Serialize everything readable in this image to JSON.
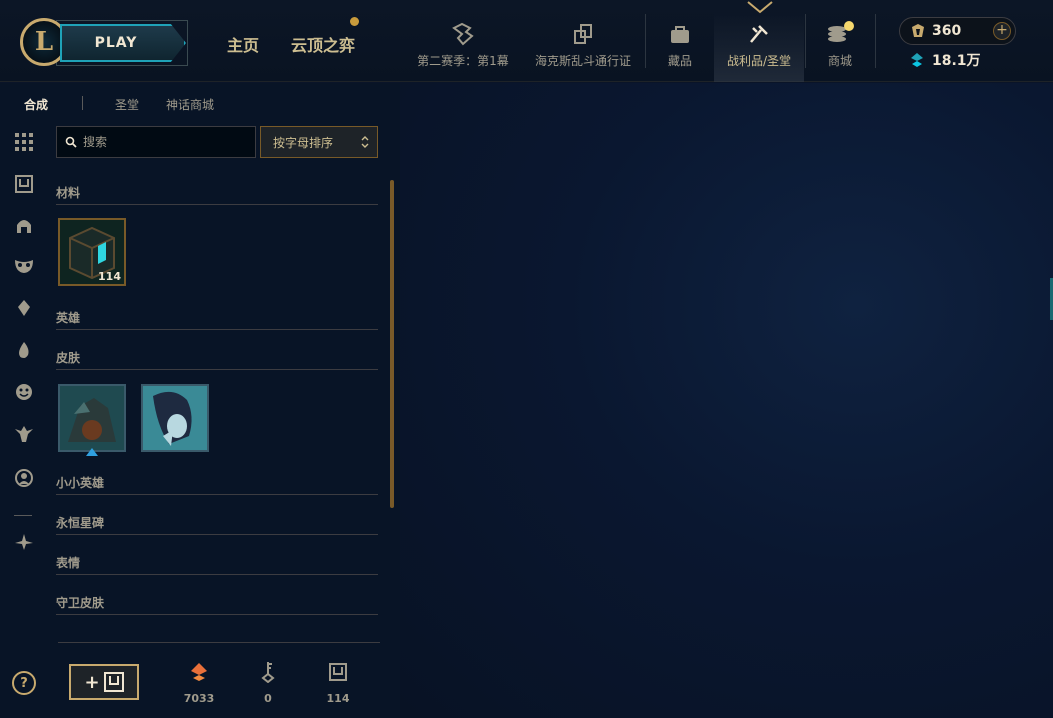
{
  "header": {
    "logo_letter": "L",
    "play_label": "PLAY",
    "nav_home": "主页",
    "nav_tft": "云顶之弈",
    "nav_items": [
      {
        "label": "第二赛季：第1幕",
        "icon": "season-pass-icon"
      },
      {
        "label": "海克斯乱斗通行证",
        "icon": "event-pass-icon"
      },
      {
        "label": "藏品",
        "icon": "collection-bag-icon"
      },
      {
        "label": "战利品/圣堂",
        "icon": "loot-icon"
      },
      {
        "label": "商城",
        "icon": "store-coins-icon"
      }
    ],
    "rp_amount": "360",
    "be_amount": "18.1万"
  },
  "subtabs": [
    "合成",
    "圣堂",
    "神话商城"
  ],
  "search": {
    "placeholder": "搜索"
  },
  "sort": {
    "selected": "按字母排序"
  },
  "categories": {
    "materials": "材料",
    "champions": "英雄",
    "skins": "皮肤",
    "little_legends": "小小英雄",
    "eternals": "永恒星碑",
    "emotes": "表情",
    "ward_skins": "守卫皮肤"
  },
  "materials_tile": {
    "count": "114"
  },
  "stats": {
    "orange_essence": "7033",
    "keys": "0",
    "chests": "114"
  },
  "colors": {
    "gold": "#c8aa6e",
    "teal": "#1fa3b8",
    "bg": "#0a1428"
  }
}
